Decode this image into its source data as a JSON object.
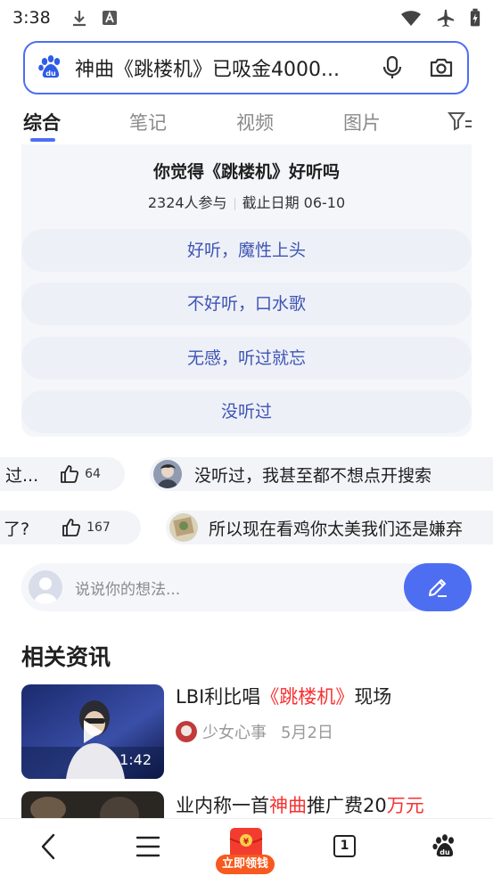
{
  "status_bar": {
    "time": "3:38"
  },
  "search": {
    "query": "神曲《跳楼机》已吸金4000..."
  },
  "tabs": [
    {
      "label": "综合",
      "active": true
    },
    {
      "label": "笔记",
      "active": false
    },
    {
      "label": "视频",
      "active": false
    },
    {
      "label": "图片",
      "active": false
    }
  ],
  "poll": {
    "title": "你觉得《跳楼机》好听吗",
    "participants": "2324人参与",
    "deadline": "截止日期 06-10",
    "options": [
      "好听，魔性上头",
      "不好听，口水歌",
      "无感，听过就忘",
      "没听过"
    ]
  },
  "danmaku": [
    {
      "text_start": "过...",
      "likes": "64",
      "text_next": "没听过，我甚至都不想点开搜索"
    },
    {
      "text_start": "了?",
      "likes": "167",
      "text_next": "所以现在看鸡你太美我们还是嫌弃"
    }
  ],
  "comment": {
    "placeholder": "说说你的想法..."
  },
  "related_news": {
    "title": "相关资讯",
    "items": [
      {
        "title_prefix": "LBI利比唱",
        "title_highlight": "《跳楼机》",
        "title_suffix": "现场",
        "source": "少女心事",
        "date": "5月2日",
        "duration": "1:42"
      },
      {
        "title_prefix": "业内称一首",
        "title_highlight": "神曲",
        "title_middle": "推广费20",
        "title_highlight2": "万元"
      }
    ]
  },
  "bottom_nav": {
    "hongbao_label": "立即领钱",
    "hongbao_badge": "¥",
    "tab_count": "1"
  },
  "colors": {
    "accent": "#4e6ef2",
    "highlight": "#f73131",
    "poll_text": "#3e55b3"
  }
}
